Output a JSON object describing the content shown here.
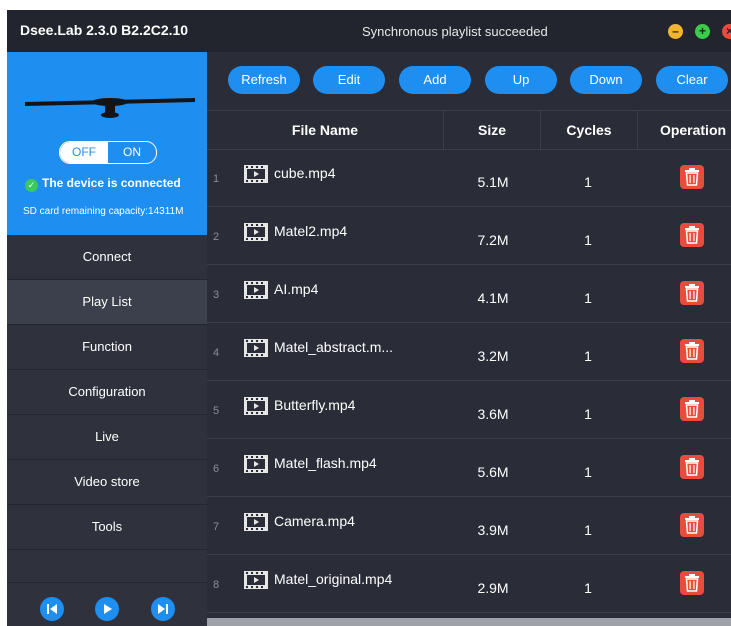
{
  "window": {
    "title": "Dsee.Lab 2.3.0 B2.2C2.10",
    "status_message": "Synchronous playlist succeeded",
    "controls": [
      "minimize-icon",
      "maximize-icon",
      "close-icon"
    ]
  },
  "device": {
    "toggle_off": "OFF",
    "toggle_on": "ON",
    "status": "The device is connected",
    "capacity": "SD card remaining capacity:14311M"
  },
  "sidebar": {
    "items": [
      {
        "label": "Connect"
      },
      {
        "label": "Play List"
      },
      {
        "label": "Function"
      },
      {
        "label": "Configuration"
      },
      {
        "label": "Live"
      },
      {
        "label": "Video store"
      },
      {
        "label": "Tools"
      }
    ],
    "active_index": 1
  },
  "player": {
    "buttons": [
      "previous-icon",
      "play-icon",
      "next-icon"
    ]
  },
  "toolbar": {
    "buttons": [
      {
        "label": "Refresh"
      },
      {
        "label": "Edit"
      },
      {
        "label": "Add"
      },
      {
        "label": "Up"
      },
      {
        "label": "Down"
      },
      {
        "label": "Clear"
      }
    ]
  },
  "table": {
    "columns": [
      "File Name",
      "Size",
      "Cycles",
      "Operation"
    ],
    "rows": [
      {
        "index": "1",
        "name": "cube.mp4",
        "size": "5.1M",
        "cycles": "1"
      },
      {
        "index": "2",
        "name": "Matel2.mp4",
        "size": "7.2M",
        "cycles": "1"
      },
      {
        "index": "3",
        "name": "AI.mp4",
        "size": "4.1M",
        "cycles": "1"
      },
      {
        "index": "4",
        "name": "Matel_abstract.m...",
        "size": "3.2M",
        "cycles": "1"
      },
      {
        "index": "5",
        "name": "Butterfly.mp4",
        "size": "3.6M",
        "cycles": "1"
      },
      {
        "index": "6",
        "name": "Matel_flash.mp4",
        "size": "5.6M",
        "cycles": "1"
      },
      {
        "index": "7",
        "name": "Camera.mp4",
        "size": "3.9M",
        "cycles": "1"
      },
      {
        "index": "8",
        "name": "Matel_original.mp4",
        "size": "2.9M",
        "cycles": "1"
      }
    ]
  },
  "colors": {
    "accent": "#1e8ef0",
    "background": "#2a2d38",
    "sidebar": "#2f323d",
    "delete": "#e74c3c",
    "connected": "#3cc95d"
  }
}
